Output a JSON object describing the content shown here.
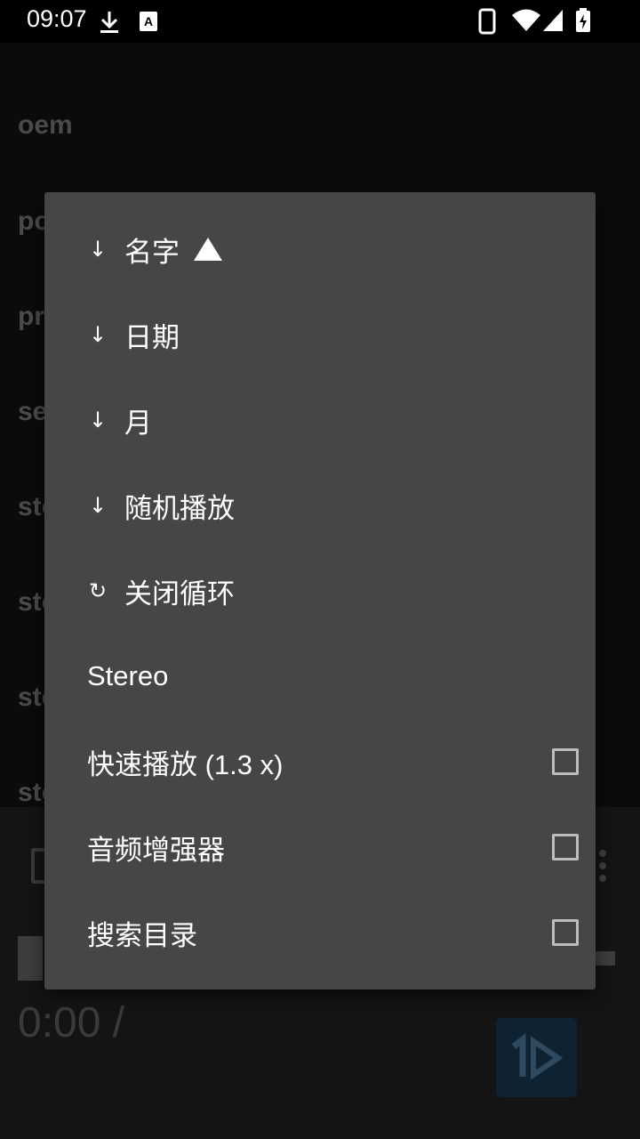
{
  "status_bar": {
    "time": "09:07",
    "icons": [
      "download-icon",
      "keyboard-a-icon",
      "phone-icon",
      "wifi-icon",
      "signal-icon",
      "battery-charging-icon"
    ]
  },
  "background": {
    "items": [
      "oem",
      "po",
      "pr",
      "se",
      "sto",
      "sto",
      "sto",
      "sto"
    ],
    "time_display": "0:00 /"
  },
  "menu": {
    "items": [
      {
        "lead": "↓",
        "label": "名字",
        "indicator": "sort-ascending-triangle"
      },
      {
        "lead": "↓",
        "label": "日期"
      },
      {
        "lead": "↓",
        "label": "月"
      },
      {
        "lead": "↓",
        "label": "随机播放"
      },
      {
        "lead": "↻",
        "label": "关闭循环"
      },
      {
        "label": "Stereo"
      },
      {
        "label": "快速播放 (1.3 x)",
        "checked": false
      },
      {
        "label": "音频增强器",
        "checked": false
      },
      {
        "label": "搜索目录",
        "checked": false
      }
    ]
  }
}
